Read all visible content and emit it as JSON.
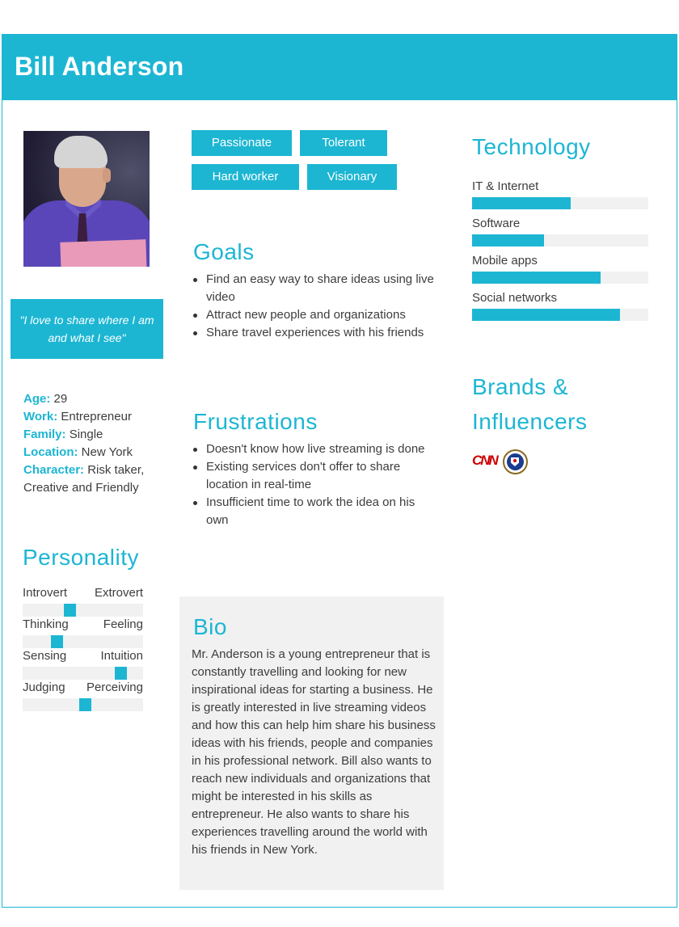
{
  "header": {
    "name": "Bill Anderson"
  },
  "quote": "\"I love to share where I am and what I see\"",
  "demographics": [
    {
      "key": "Age",
      "value": " 29"
    },
    {
      "key": "Work",
      "value": " Entrepreneur"
    },
    {
      "key": "Family",
      "value": " Single"
    },
    {
      "key": "Location",
      "value": " New York"
    },
    {
      "key": "Character",
      "value": " Risk taker, Creative and Friendly"
    }
  ],
  "personality": {
    "title": "Personality",
    "scales": [
      {
        "left": "Introvert",
        "right": "Extrovert",
        "level": 0.38
      },
      {
        "left": "Thinking",
        "right": "Feeling",
        "level": 0.26
      },
      {
        "left": "Sensing",
        "right": "Intuition",
        "level": 0.85
      },
      {
        "left": "Judging",
        "right": "Perceiving",
        "level": 0.52
      }
    ]
  },
  "traits": [
    "Passionate",
    "Tolerant",
    "Hard worker",
    "Visionary"
  ],
  "goals": {
    "title": "Goals",
    "items": [
      "Find an easy way to share ideas using live video",
      "Attract new people and organizations",
      "Share travel experiences with his friends"
    ]
  },
  "frustrations": {
    "title": "Frustrations",
    "items": [
      "Doesn't know how live streaming is done",
      "Existing services don't offer to share location in real-time",
      "Insufficient time to work the idea on his own"
    ]
  },
  "bio": {
    "title": "Bio",
    "text": "Mr. Anderson is a young entrepreneur that is constantly travelling and looking for new inspirational ideas for starting a business. He is greatly interested in live streaming videos and how this can help him share his business ideas with his friends, people and companies in his professional network. Bill also wants to reach new individuals and organizations that might be interested in his skills as entrepreneur. He also wants to share his experiences travelling around the world with his friends in New York."
  },
  "technology": {
    "title": "Technology",
    "items": [
      {
        "label": "IT & Internet",
        "level": 0.56
      },
      {
        "label": "Software",
        "level": 0.41
      },
      {
        "label": "Mobile apps",
        "level": 0.73
      },
      {
        "label": "Social networks",
        "level": 0.84
      }
    ]
  },
  "brands": {
    "title_line1": "Brands &",
    "title_line2": "Influencers",
    "logos": [
      {
        "name": "CNN",
        "icon": "cnn-logo"
      },
      {
        "name": "CIA",
        "icon": "cia-seal-icon"
      }
    ]
  },
  "colors": {
    "accent": "#1cb6d3",
    "panel": "#f1f1f1",
    "text": "#3d3d3d"
  }
}
